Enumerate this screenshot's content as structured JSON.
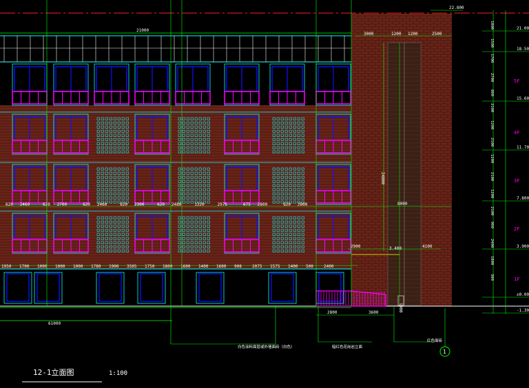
{
  "drawing": {
    "title": "12-1立面图",
    "scale": "1:100",
    "grid_bubble": "1"
  },
  "colors": {
    "background": "#000000",
    "brick": "#6a2418",
    "brick_mortar": "#2a0a06",
    "dim_green": "#00ff00",
    "white": "#ffffff",
    "cyan": "#00ffff",
    "blue": "#1010ff",
    "magenta": "#ff00ff",
    "yellow": "#ffff00",
    "red_dash": "#ff2020",
    "stair_brown": "#3a2015",
    "level_label": "#ff00ff"
  },
  "dimensions": {
    "top_overall": "21000",
    "right_top_level": "22.800",
    "bottom_left": "61000",
    "stair_top": [
      "3000",
      "1200",
      "1200",
      "2500"
    ],
    "stair_height": "24800",
    "stair_tall": "8000",
    "bay_row": [
      "620",
      "2460",
      "620",
      "2700",
      "620",
      "2460",
      "620",
      "2300",
      "620",
      "2480",
      "1320",
      "2975",
      "675",
      "2800",
      "620",
      "2800"
    ],
    "ground_row": [
      "1950",
      "1700",
      "1000",
      "1000",
      "1000",
      "1780",
      "1900",
      "3505",
      "1750",
      "1800",
      "1600",
      "1400",
      "1600",
      "908",
      "2075",
      "1575",
      "1400",
      "500",
      "2400"
    ],
    "landing": [
      "2900",
      "3.400",
      "4100"
    ],
    "bottom_row": [
      "2800",
      "3600"
    ],
    "stair_foot": "1900"
  },
  "levels": [
    {
      "label": "21.000"
    },
    {
      "label": "18.500"
    },
    {
      "label": "15.600"
    },
    {
      "label": "11.700"
    },
    {
      "label": "7.800"
    },
    {
      "label": "3.900"
    },
    {
      "label": "±0.000"
    },
    {
      "label": "-1.30"
    }
  ],
  "floors": [
    "5F",
    "4F",
    "3F",
    "2F",
    "1F"
  ],
  "right_dims": [
    "1800",
    "1500",
    "1700",
    "2700",
    "800",
    "2100",
    "1200",
    "2100",
    "1200",
    "2100",
    "1200",
    "2100",
    "900",
    "2400",
    "1800",
    "300"
  ],
  "callouts": [
    {
      "text": "白色涂料面层或外墙面砖（白色）"
    },
    {
      "text": "暗红色花岗岩立面"
    },
    {
      "text": "红色面砖"
    }
  ]
}
